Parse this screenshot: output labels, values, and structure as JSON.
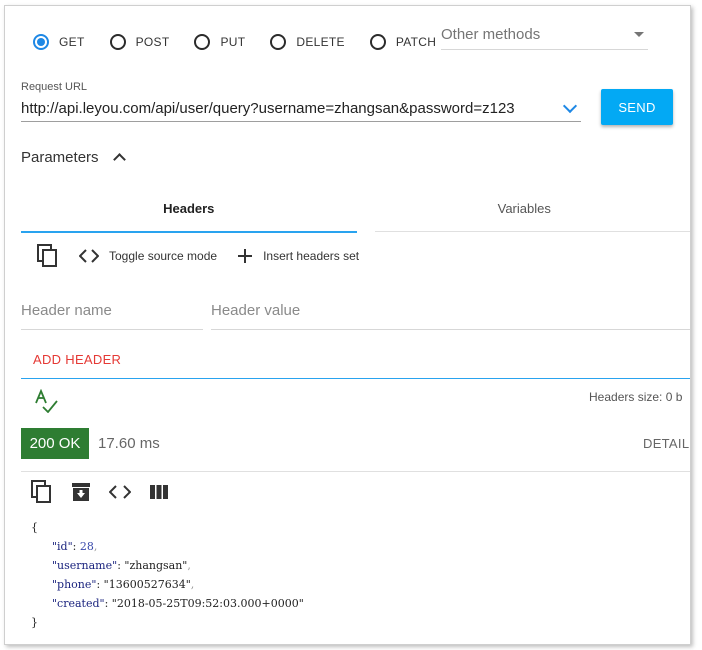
{
  "methods": [
    {
      "label": "GET",
      "checked": true
    },
    {
      "label": "POST",
      "checked": false
    },
    {
      "label": "PUT",
      "checked": false
    },
    {
      "label": "DELETE",
      "checked": false
    },
    {
      "label": "PATCH",
      "checked": false
    }
  ],
  "other_methods": "Other methods",
  "request": {
    "url_label": "Request URL",
    "url_value": "http://api.leyou.com/api/user/query?username=zhangsan&password=z123",
    "send_label": "SEND"
  },
  "parameters": {
    "label": "Parameters"
  },
  "tabs": {
    "headers": "Headers",
    "variables": "Variables"
  },
  "toolbar": {
    "toggle_source": "Toggle source mode",
    "insert_headers": "Insert headers set"
  },
  "header_fields": {
    "name_placeholder": "Header name",
    "value_placeholder": "Header value"
  },
  "add_header": "ADD HEADER",
  "headers_size": "Headers size: 0 b",
  "response": {
    "status": "200 OK",
    "time": "17.60 ms",
    "details": "DETAILS",
    "json": {
      "open": "{",
      "close": "}",
      "fields": [
        {
          "key": "\"id\"",
          "value": "28",
          "type": "num"
        },
        {
          "key": "\"username\"",
          "value": "\"zhangsan\"",
          "type": "str"
        },
        {
          "key": "\"phone\"",
          "value": "\"13600527634\"",
          "type": "str"
        },
        {
          "key": "\"created\"",
          "value": "\"2018-05-25T09:52:03.000+0000\"",
          "type": "str"
        }
      ]
    }
  },
  "colors": {
    "accent": "#03a9f4",
    "radio": "#1e88e5",
    "success": "#2e7d32",
    "add_header": "#e53935"
  }
}
